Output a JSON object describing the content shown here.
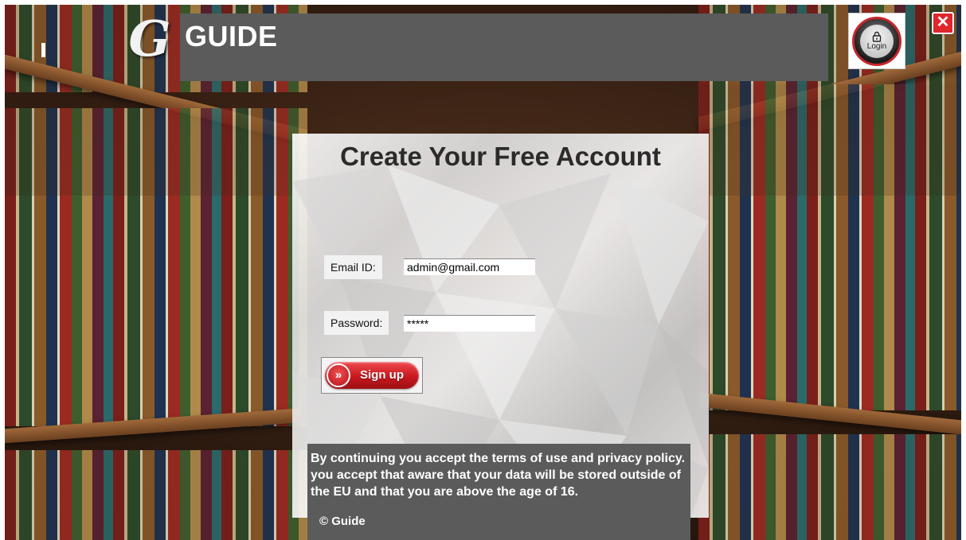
{
  "header": {
    "logo_letter": "G",
    "title": "GUIDE",
    "login_label": "Login",
    "close_label": "✕"
  },
  "signup": {
    "title": "Create Your Free Account",
    "email_label": "Email ID:",
    "email_value": "admin@gmail.com",
    "password_label": "Password:",
    "password_value": "*****",
    "button_arrow": "»",
    "button_label": "Sign up"
  },
  "terms": {
    "text": "By continuing you accept the terms of use and privacy policy. you accept that aware that your data will be stored outside of the EU and that you are above the age of 16.",
    "copyright": "© Guide"
  },
  "colors": {
    "header_bar": "#5b5b5b",
    "accent_red": "#e0262c",
    "button_red": "#c8181e"
  }
}
